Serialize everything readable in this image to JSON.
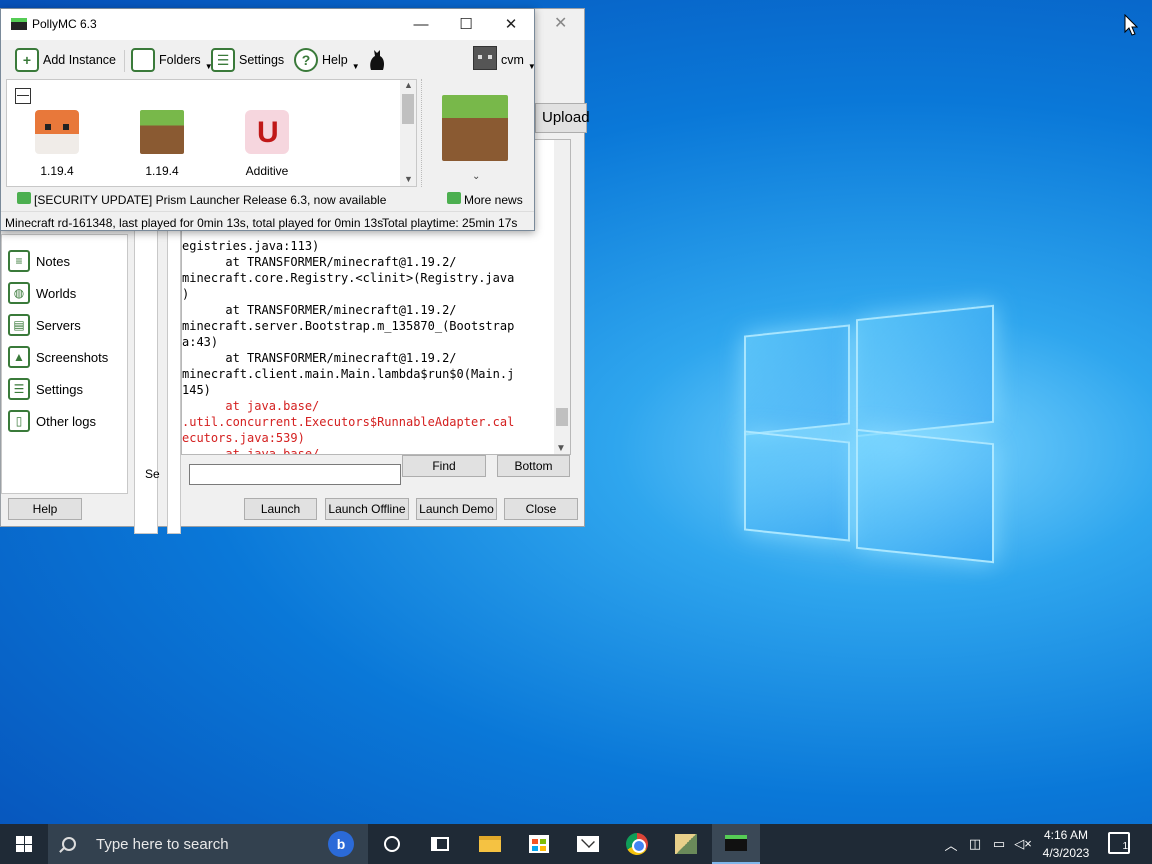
{
  "main_window": {
    "title": "PollyMC 6.3",
    "toolbar": {
      "add_instance": "Add Instance",
      "folders": "Folders",
      "settings": "Settings",
      "help": "Help",
      "account": "cvm"
    },
    "instances": [
      {
        "name": "1.19.4",
        "icon": "fox-icon"
      },
      {
        "name": "1.19.4",
        "icon": "grass-block-icon"
      },
      {
        "name": "Additive",
        "icon": "additive-icon"
      }
    ],
    "news": {
      "headline": "[SECURITY UPDATE] Prism Launcher Release 6.3, now available",
      "more_news": "More news"
    },
    "status": {
      "left": "Minecraft rd-161348, last played for 0min 13s, total played for 0min 13s",
      "right": "Total playtime: 25min 17s"
    }
  },
  "log_window": {
    "upload_label": "Upload",
    "side_items": [
      {
        "label": "Notes",
        "icon": "notes-icon"
      },
      {
        "label": "Worlds",
        "icon": "worlds-icon"
      },
      {
        "label": "Servers",
        "icon": "servers-icon"
      },
      {
        "label": "Screenshots",
        "icon": "screenshots-icon"
      },
      {
        "label": "Settings",
        "icon": "settings-icon"
      },
      {
        "label": "Other logs",
        "icon": "other-logs-icon"
      }
    ],
    "log_lines": [
      {
        "text": "egistries.java:113)",
        "error": false
      },
      {
        "text": "      at TRANSFORMER/minecraft@1.19.2/",
        "error": false
      },
      {
        "text": "minecraft.core.Registry.<clinit>(Registry.java",
        "error": false
      },
      {
        "text": ")",
        "error": false
      },
      {
        "text": "      at TRANSFORMER/minecraft@1.19.2/",
        "error": false
      },
      {
        "text": "minecraft.server.Bootstrap.m_135870_(Bootstrap",
        "error": false
      },
      {
        "text": "a:43)",
        "error": false
      },
      {
        "text": "      at TRANSFORMER/minecraft@1.19.2/",
        "error": false
      },
      {
        "text": "minecraft.client.main.Main.lambda$run$0(Main.j",
        "error": false
      },
      {
        "text": "145)",
        "error": false
      },
      {
        "text": "      at java.base/",
        "error": true
      },
      {
        "text": ".util.concurrent.Executors$RunnableAdapter.cal",
        "error": true
      },
      {
        "text": "ecutors.java:539)",
        "error": true
      },
      {
        "text": "      at java.base/",
        "error": true
      }
    ],
    "find_label": "Find",
    "bottom_label": "Bottom",
    "se_label": "Se",
    "help_label": "Help",
    "launch_label": "Launch",
    "launch_offline_label": "Launch Offline",
    "launch_demo_label": "Launch Demo",
    "close_label": "Close"
  },
  "taskbar": {
    "search_placeholder": "Type here to search",
    "time": "4:16 AM",
    "date": "4/3/2023",
    "notification_count": "1"
  }
}
